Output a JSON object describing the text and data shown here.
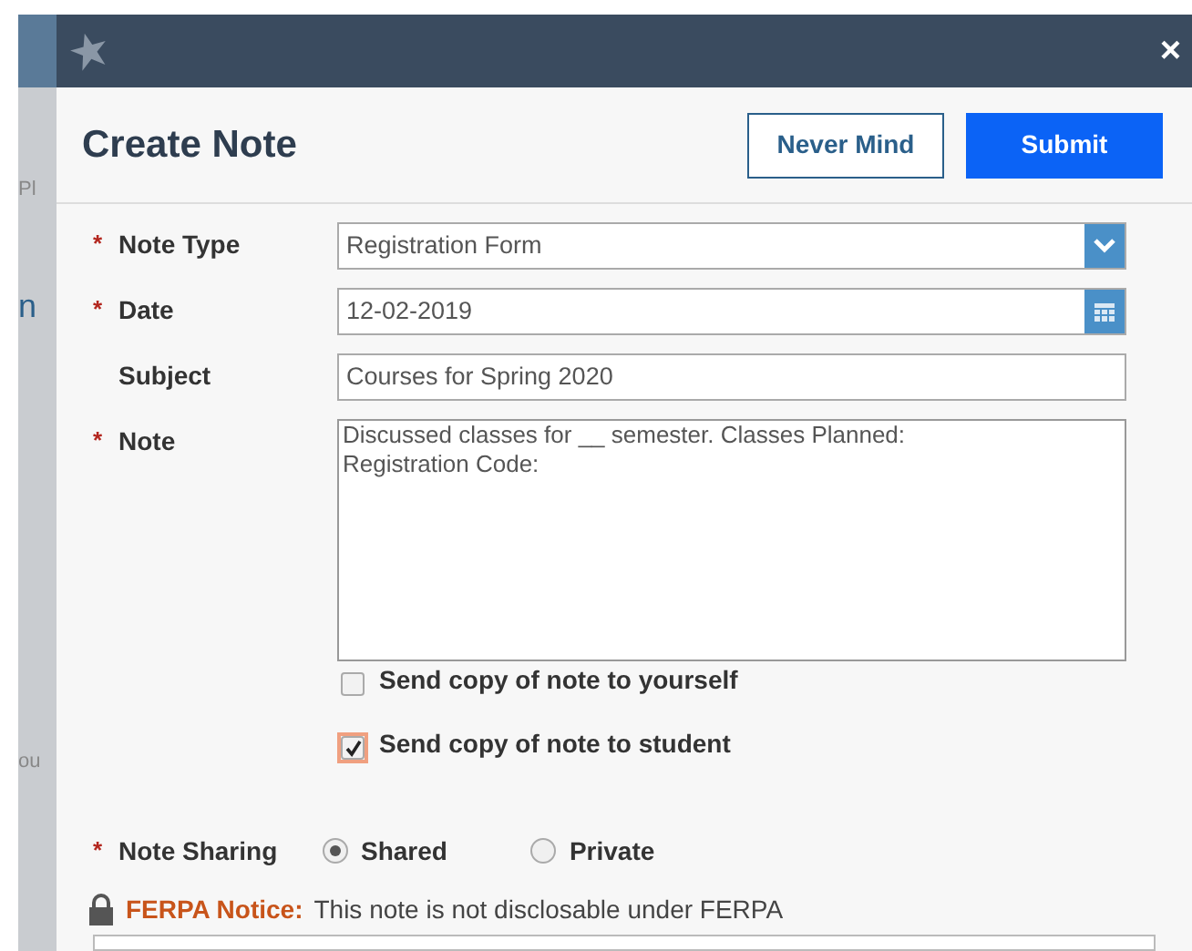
{
  "background_fragments": [
    {
      "text": "Pl"
    },
    {
      "text": "n"
    },
    {
      "text": "ou"
    }
  ],
  "dialog": {
    "close": "×",
    "title": "Create Note",
    "buttons": [
      {
        "label": "Never Mind",
        "kind": "secondary"
      },
      {
        "label": "Submit",
        "kind": "primary"
      }
    ]
  },
  "fields": [
    {
      "label": "Note Type",
      "required": true,
      "kind": "select",
      "value": "Registration Form"
    },
    {
      "label": "Date",
      "required": true,
      "kind": "date",
      "value": "12-02-2019"
    },
    {
      "label": "Subject",
      "required": false,
      "kind": "text",
      "value": "Courses for Spring 2020"
    },
    {
      "label": "Note",
      "required": true,
      "kind": "textarea",
      "value": "Discussed classes for __ semester. Classes Planned:\nRegistration Code:"
    }
  ],
  "required_mark": "*",
  "checkboxes": [
    {
      "label": "Send copy of note to yourself",
      "checked": false,
      "focused": false
    },
    {
      "label": "Send copy of note to student",
      "checked": true,
      "focused": true
    }
  ],
  "sharing": {
    "label": "Note Sharing",
    "required": true,
    "options": [
      {
        "label": "Shared",
        "selected": true
      },
      {
        "label": "Private",
        "selected": false
      }
    ]
  },
  "notice": {
    "title": "FERPA Notice:",
    "text": "This note is not disclosable under FERPA"
  }
}
